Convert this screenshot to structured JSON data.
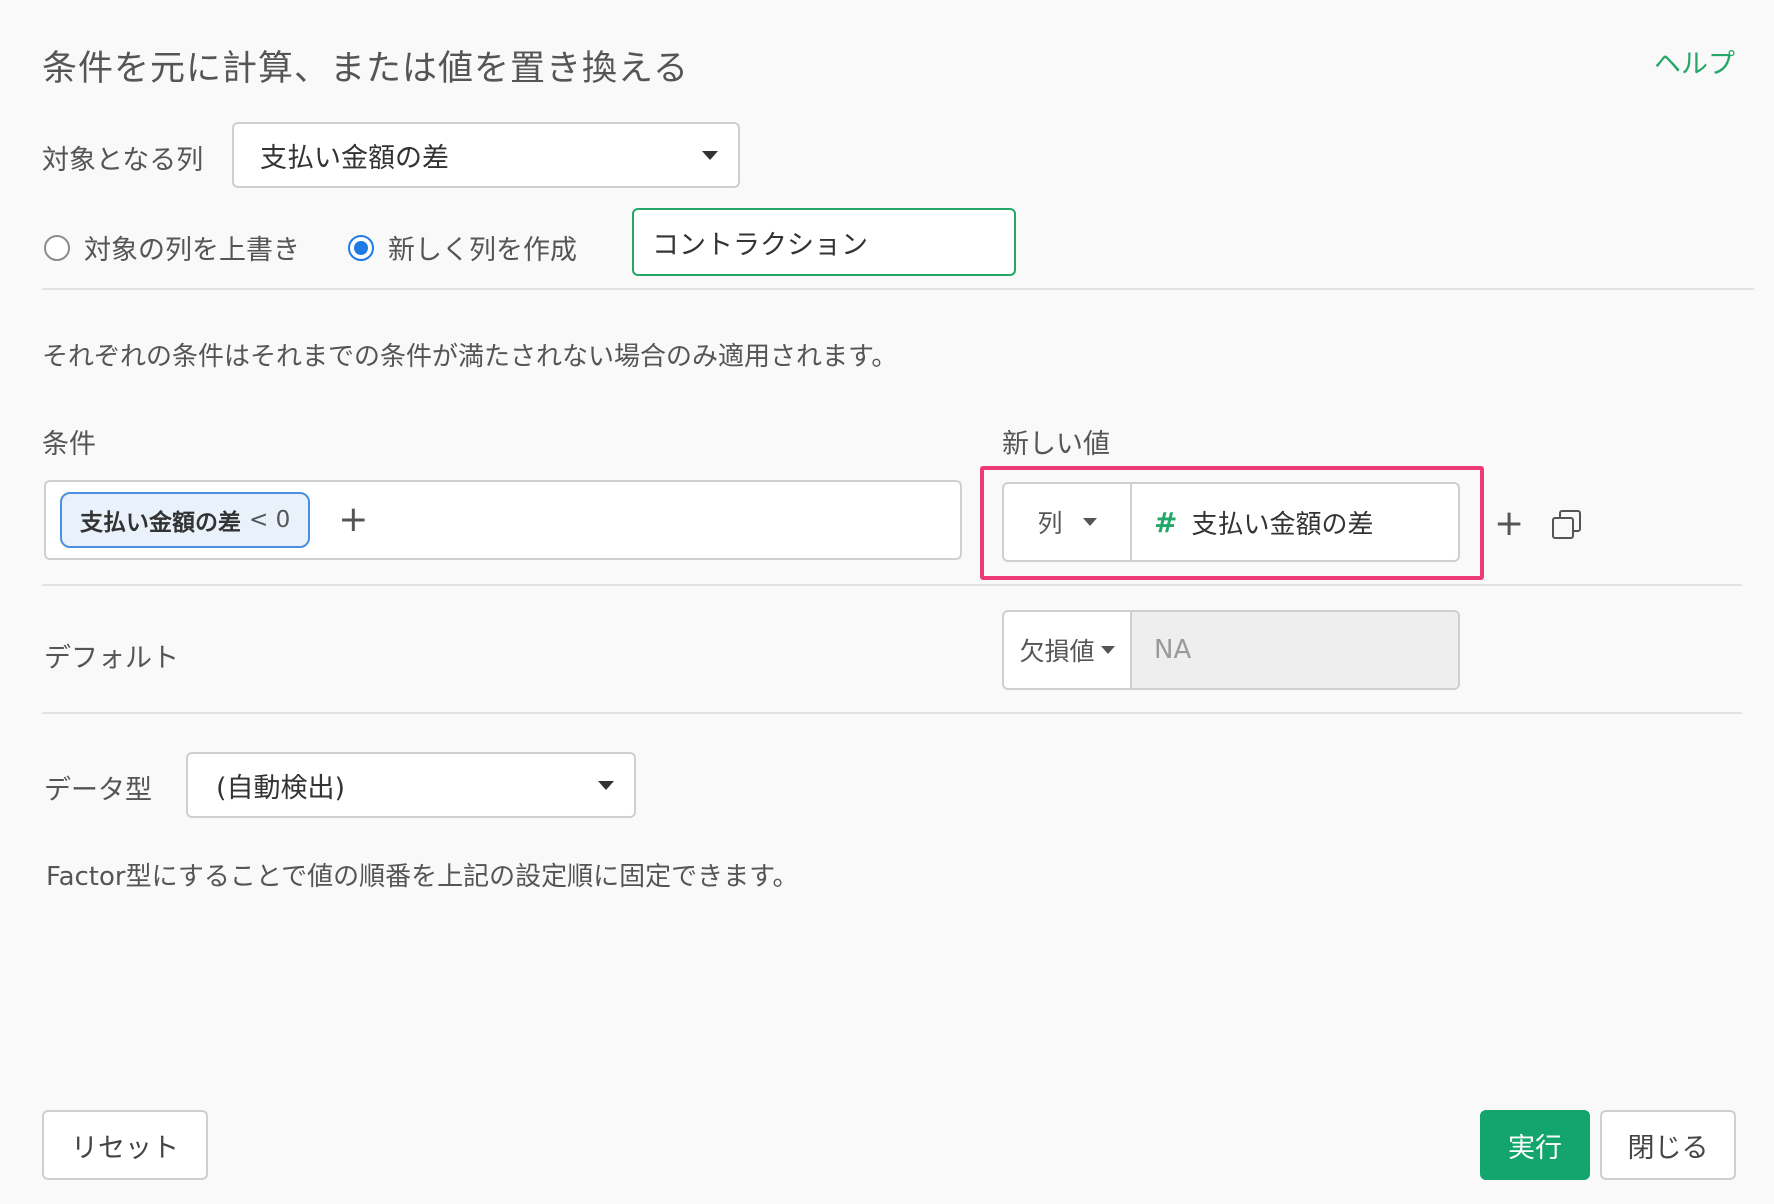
{
  "header": {
    "title": "条件を元に計算、または値を置き換える",
    "help_label": "ヘルプ"
  },
  "target_column": {
    "label": "対象となる列",
    "value": "支払い金額の差"
  },
  "mode": {
    "overwrite_label": "対象の列を上書き",
    "create_label": "新しく列を作成",
    "selected": "create",
    "new_column_name": "コントラクション"
  },
  "note": "それぞれの条件はそれまでの条件が満たされない場合のみ適用されます。",
  "conditions": {
    "header_condition": "条件",
    "header_new_value": "新しい値",
    "rows": [
      {
        "chip_column": "支払い金額の差",
        "chip_operator": "< 0",
        "value_type": "列",
        "value_icon": "#",
        "value": "支払い金額の差"
      }
    ],
    "highlight_color": "#ef3a79"
  },
  "default": {
    "label": "デフォルト",
    "type": "欠損値",
    "value": "NA"
  },
  "data_type": {
    "label": "データ型",
    "value": "(自動検出)",
    "note": "Factor型にすることで値の順番を上記の設定順に固定できます。"
  },
  "footer": {
    "reset_label": "リセット",
    "run_label": "実行",
    "close_label": "閉じる"
  },
  "colors": {
    "accent": "#13a56c",
    "link": "#24a86a",
    "radio_selected": "#1f7ae6"
  }
}
